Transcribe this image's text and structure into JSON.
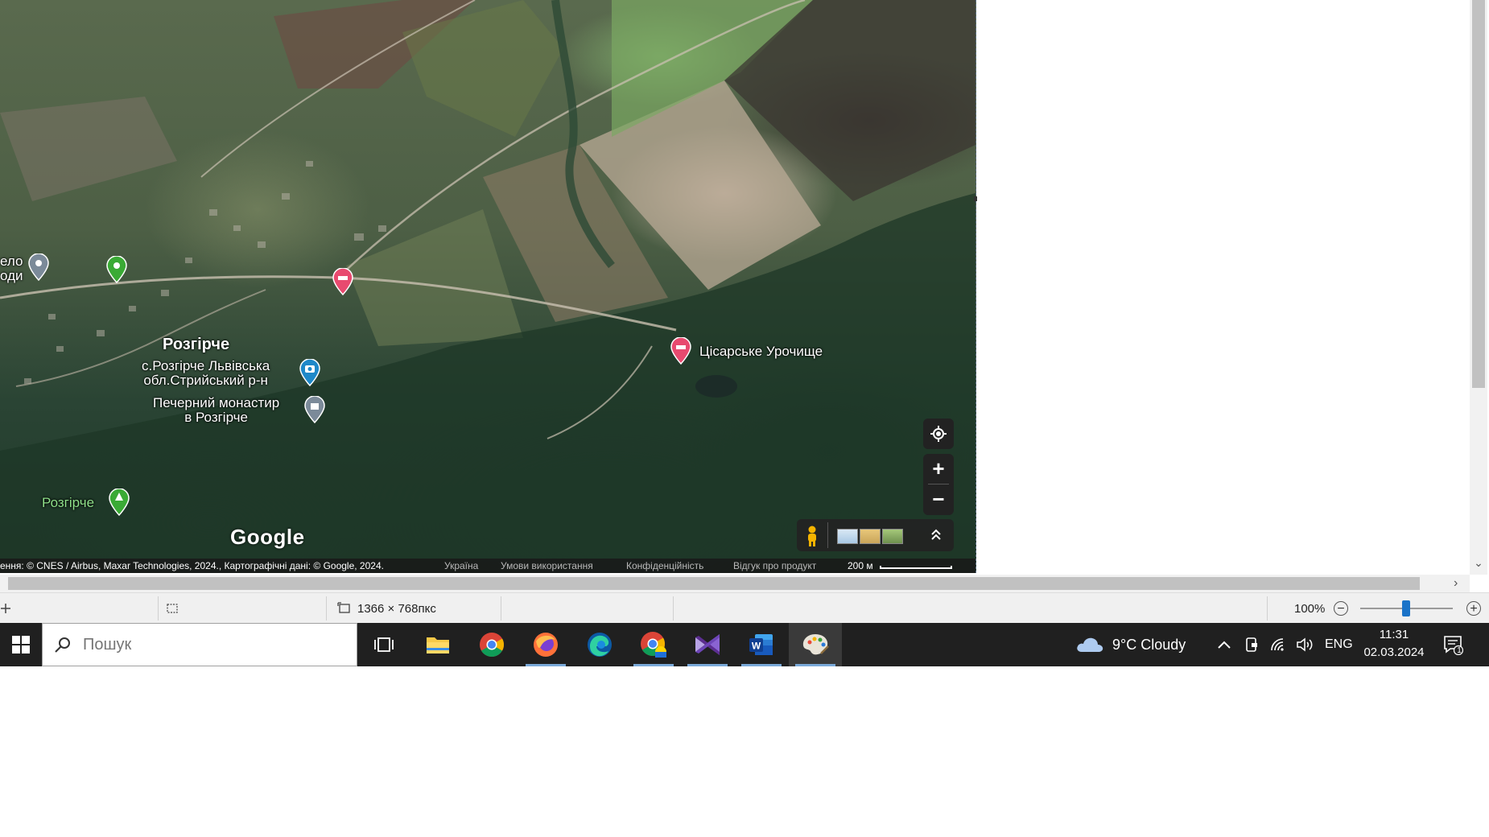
{
  "map": {
    "places": {
      "village_fragment": "ело\nоди",
      "village_label": "Розгірче",
      "photo_label": "с.Розгірче Львівська\nобл.Стрийський р-н",
      "monastery_label": "Печерний монастир\nв Розгірче",
      "park_label": "Розгірче",
      "tract_label": "Цісарське Урочище"
    },
    "logo": "Google",
    "controls": {
      "zoom_in": "+",
      "zoom_out": "−"
    },
    "attribution": {
      "imagery": "ення: © CNES / Airbus, Maxar Technologies, 2024., Картографічні дані: © Google, 2024.",
      "country": "Україна",
      "terms": "Умови використання",
      "privacy": "Конфіденційність",
      "feedback": "Відгук про продукт",
      "scale": "200 м"
    }
  },
  "statusbar": {
    "image_size": "1366 × 768пкс",
    "zoom": "100%"
  },
  "taskbar": {
    "search_placeholder": "Пошук",
    "weather": "9°C  Cloudy",
    "language": "ENG",
    "time": "11:31",
    "date": "02.03.2024",
    "notification_count": "1",
    "apps": [
      "task-view",
      "file-explorer",
      "chrome",
      "firefox",
      "edge",
      "chrome-profile",
      "visual-studio",
      "word",
      "paint"
    ]
  },
  "colors": {
    "taskbar_bg": "#202020",
    "pin_red": "#e84a6f",
    "pin_green": "#3aaa35",
    "pin_grey": "#7b8a99",
    "pin_blue": "#1e88c8",
    "accent_blue": "#1a73c8"
  }
}
